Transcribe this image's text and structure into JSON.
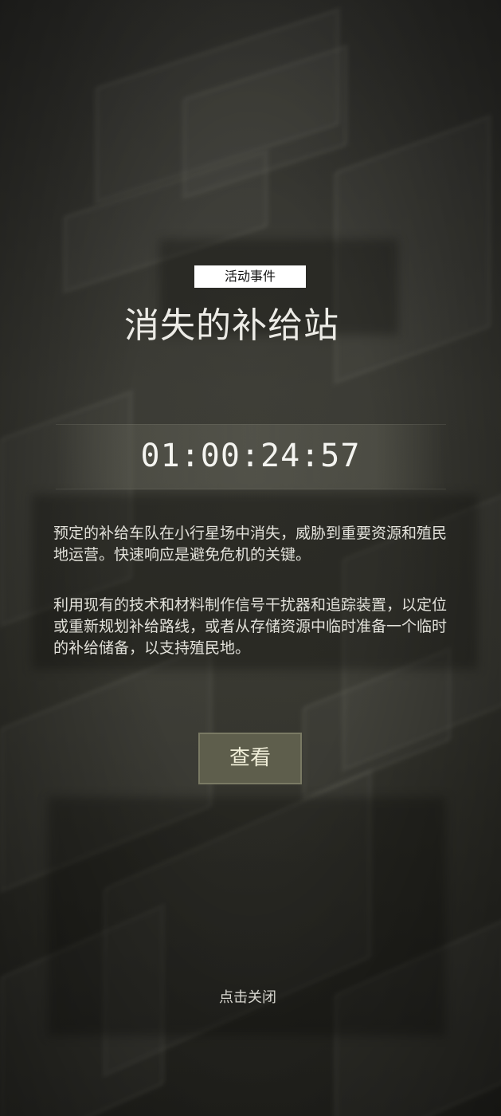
{
  "event": {
    "tag": "活动事件",
    "title": "消失的补给站",
    "countdown": "01:00:24:57",
    "description_1": "预定的补给车队在小行星场中消失，威胁到重要资源和殖民地运营。快速响应是避免危机的关键。",
    "description_2": "利用现有的技术和材料制作信号干扰器和追踪装置，以定位或重新规划补给路线，或者从存储资源中临时准备一个临时的补给储备，以支持殖民地。"
  },
  "actions": {
    "view_label": "查看",
    "close_label": "点击关闭"
  },
  "colors": {
    "button_bg": "#5e5e4c",
    "tag_bg": "#ffffff",
    "text": "#e2e1da"
  }
}
